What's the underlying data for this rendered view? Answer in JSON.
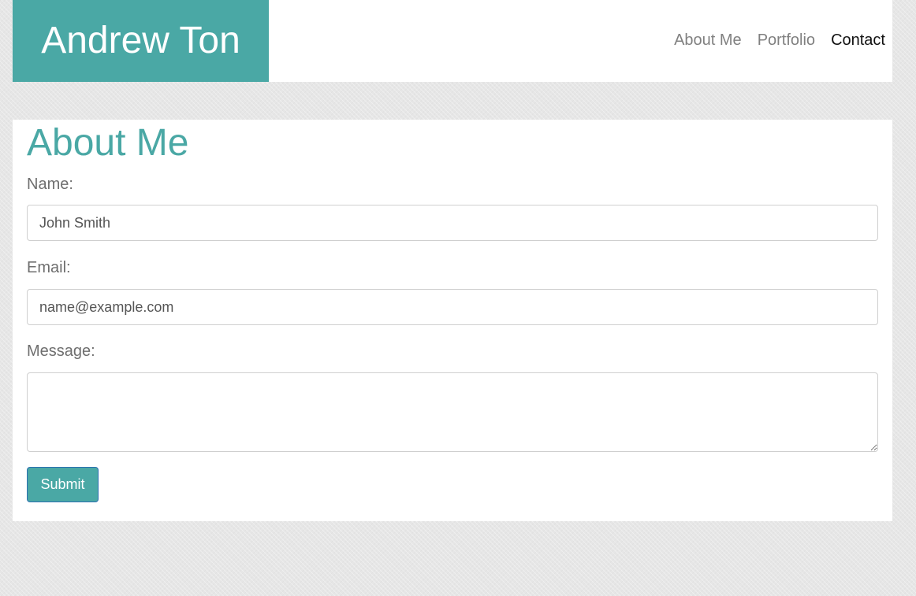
{
  "header": {
    "brand": "Andrew Ton",
    "nav": [
      {
        "label": "About Me",
        "active": false
      },
      {
        "label": "Portfolio",
        "active": false
      },
      {
        "label": "Contact",
        "active": true
      }
    ]
  },
  "main": {
    "title": "About Me",
    "form": {
      "name": {
        "label": "Name:",
        "placeholder": "John Smith",
        "value": ""
      },
      "email": {
        "label": "Email:",
        "placeholder": "name@example.com",
        "value": ""
      },
      "message": {
        "label": "Message:",
        "placeholder": "",
        "value": ""
      },
      "submit_label": "Submit"
    }
  },
  "colors": {
    "accent": "#4aa8a5",
    "page_background": "#e6e6e6",
    "nav_inactive": "#808080",
    "nav_active": "#111111"
  }
}
